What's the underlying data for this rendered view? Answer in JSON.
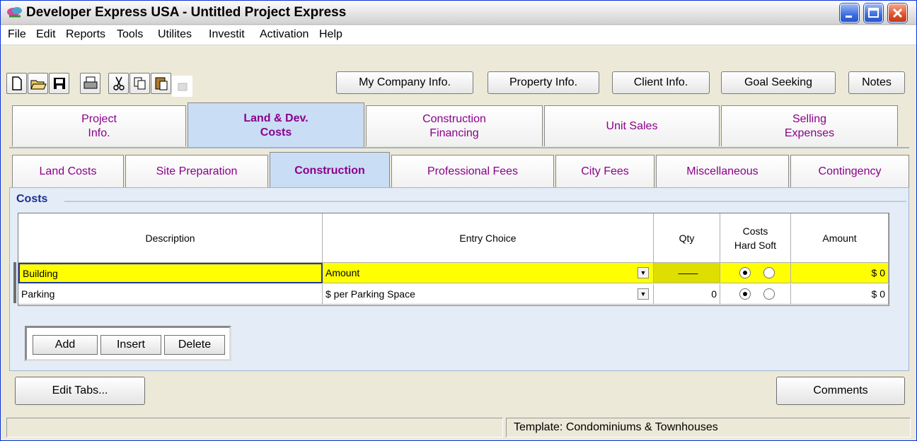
{
  "window": {
    "title": "Developer Express  USA - Untitled Project Express"
  },
  "menu": [
    "File",
    "Edit",
    "Reports",
    "Tools",
    "Utilites",
    "Investit",
    "Activation",
    "Help"
  ],
  "toolbar": {
    "icons": [
      "new-document-icon",
      "open-folder-icon",
      "save-icon",
      "print-icon",
      "cut-icon",
      "copy-icon",
      "paste-icon",
      "disabled-icon"
    ],
    "buttons": [
      "My Company Info.",
      "Property Info.",
      "Client Info.",
      "Goal Seeking",
      "Notes"
    ]
  },
  "main_tabs": [
    {
      "l1": "Project",
      "l2": "Info."
    },
    {
      "l1": "Land & Dev.",
      "l2": "Costs"
    },
    {
      "l1": "Construction",
      "l2": "Financing"
    },
    {
      "l1": "Unit Sales",
      "l2": ""
    },
    {
      "l1": "Selling",
      "l2": "Expenses"
    }
  ],
  "sub_tabs": [
    "Land Costs",
    "Site Preparation",
    "Construction",
    "Professional Fees",
    "City Fees",
    "Miscellaneous",
    "Contingency"
  ],
  "section": {
    "title": "Costs"
  },
  "table": {
    "headers": {
      "description": "Description",
      "entry": "Entry Choice",
      "qty": "Qty",
      "costs1": "Costs",
      "costs2": "Hard Soft",
      "amount": "Amount"
    },
    "rows": [
      {
        "description": "Building",
        "entry": "Amount",
        "qty": "——",
        "amount": "$ 0",
        "hard": true
      },
      {
        "description": "Parking",
        "entry": "$ per Parking Space",
        "qty": "0",
        "amount": "$ 0",
        "hard": true
      }
    ]
  },
  "row_buttons": {
    "add": "Add",
    "insert": "Insert",
    "delete": "Delete"
  },
  "bottom": {
    "edit_tabs": "Edit Tabs...",
    "comments": "Comments"
  },
  "status": {
    "left": "",
    "template": "Template: Condominiums & Townhouses"
  }
}
